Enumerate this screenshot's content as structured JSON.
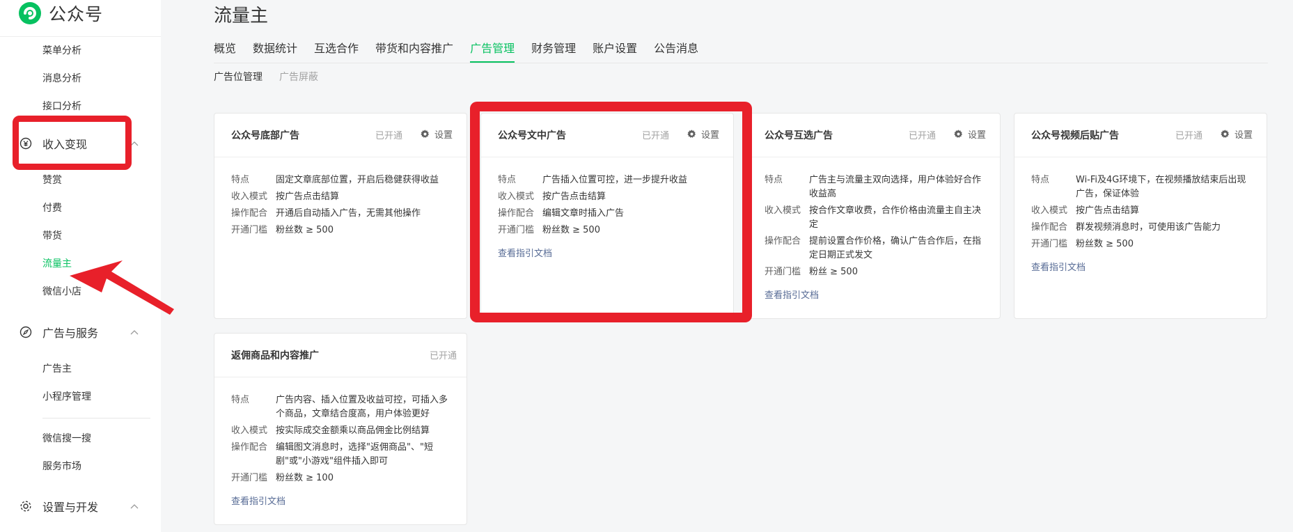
{
  "brand": {
    "name": "公众号"
  },
  "sidebar": {
    "items_top": [
      {
        "label": "菜单分析"
      },
      {
        "label": "消息分析"
      },
      {
        "label": "接口分析"
      }
    ],
    "group_income": {
      "label": "收入变现"
    },
    "income_items": [
      {
        "label": "赞赏"
      },
      {
        "label": "付费"
      },
      {
        "label": "带货"
      },
      {
        "label": "流量主"
      },
      {
        "label": "微信小店"
      }
    ],
    "group_ads": {
      "label": "广告与服务"
    },
    "ads_items": [
      {
        "label": "广告主"
      },
      {
        "label": "小程序管理"
      },
      {
        "label": "微信搜一搜"
      },
      {
        "label": "服务市场"
      }
    ],
    "group_settings": {
      "label": "设置与开发"
    }
  },
  "page": {
    "title": "流量主"
  },
  "tabs": [
    {
      "label": "概览"
    },
    {
      "label": "数据统计"
    },
    {
      "label": "互选合作"
    },
    {
      "label": "带货和内容推广"
    },
    {
      "label": "广告管理"
    },
    {
      "label": "财务管理"
    },
    {
      "label": "账户设置"
    },
    {
      "label": "公告消息"
    }
  ],
  "subtabs": [
    {
      "label": "广告位管理"
    },
    {
      "label": "广告屏蔽"
    }
  ],
  "labels": {
    "feature": "特点",
    "income_mode": "收入模式",
    "operation": "操作配合",
    "threshold": "开通门槛",
    "status_open": "已开通",
    "settings": "设置",
    "doc_link": "查看指引文档"
  },
  "cards": [
    {
      "title": "公众号底部广告",
      "feature": "固定文章底部位置，开启后稳健获得收益",
      "income_mode": "按广告点击结算",
      "operation": "开通后自动插入广告，无需其他操作",
      "threshold": "粉丝数 ≥ 500"
    },
    {
      "title": "公众号文中广告",
      "feature": "广告插入位置可控，进一步提升收益",
      "income_mode": "按广告点击结算",
      "operation": "编辑文章时插入广告",
      "threshold": "粉丝数 ≥ 500"
    },
    {
      "title": "公众号互选广告",
      "feature": "广告主与流量主双向选择，用户体验好合作收益高",
      "income_mode": "按合作文章收费，合作价格由流量主自主决定",
      "operation": "提前设置合作价格，确认广告合作后，在指定日期正式发文",
      "threshold": "粉丝 ≥ 500"
    },
    {
      "title": "公众号视频后贴广告",
      "feature": "Wi-Fi及4G环境下，在视频播放结束后出现广告，保证体验",
      "income_mode": "按广告点击结算",
      "operation": "群发视频消息时，可使用该广告能力",
      "threshold": "粉丝数 ≥ 500"
    },
    {
      "title": "返佣商品和内容推广",
      "feature": "广告内容、插入位置及收益可控，可插入多个商品，文章结合度高，用户体验更好",
      "income_mode": "按实际成交金额乘以商品佣金比例结算",
      "operation": "编辑图文消息时，选择\"返佣商品\"、\"短剧\"或\"小游戏\"组件插入即可",
      "threshold": "粉丝数 ≥ 100"
    }
  ],
  "colors": {
    "accent": "#07c160",
    "link": "#576b95",
    "annotation": "#e8202a"
  }
}
